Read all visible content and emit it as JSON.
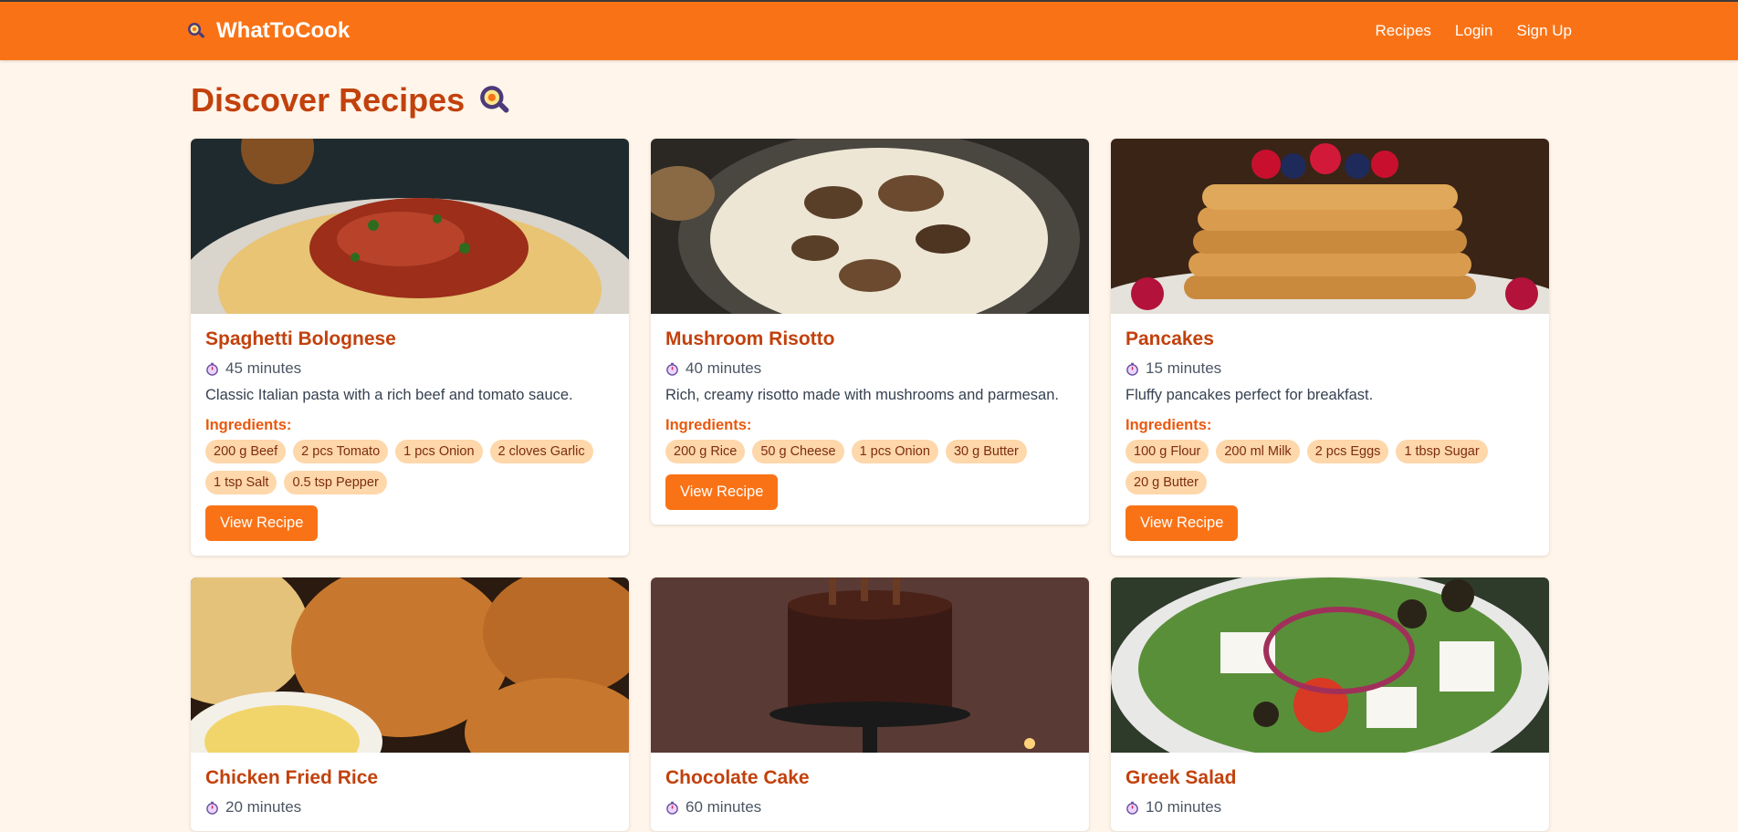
{
  "app": {
    "brand": "WhatToCook"
  },
  "nav": {
    "links": [
      "Recipes",
      "Login",
      "Sign Up"
    ]
  },
  "page": {
    "title": "Discover Recipes"
  },
  "labels": {
    "ingredients": "Ingredients:",
    "view_recipe": "View Recipe"
  },
  "colors": {
    "primary": "#f97316",
    "title": "#c2410c",
    "pill": "#fed7aa",
    "background": "#fff5ea"
  },
  "recipes": [
    {
      "title": "Spaghetti Bolognese",
      "time": "45 minutes",
      "description": "Classic Italian pasta with a rich beef and tomato sauce.",
      "ingredients": [
        "200 g Beef",
        "2 pcs Tomato",
        "1 pcs Onion",
        "2 cloves Garlic",
        "1 tsp Salt",
        "0.5 tsp Pepper"
      ],
      "image": "spaghetti-photo"
    },
    {
      "title": "Mushroom Risotto",
      "time": "40 minutes",
      "description": "Rich, creamy risotto made with mushrooms and parmesan.",
      "ingredients": [
        "200 g Rice",
        "50 g Cheese",
        "1 pcs Onion",
        "30 g Butter"
      ],
      "image": "risotto-photo"
    },
    {
      "title": "Pancakes",
      "time": "15 minutes",
      "description": "Fluffy pancakes perfect for breakfast.",
      "ingredients": [
        "100 g Flour",
        "200 ml Milk",
        "2 pcs Eggs",
        "1 tbsp Sugar",
        "20 g Butter"
      ],
      "image": "pancakes-photo"
    },
    {
      "title": "Chicken Fried Rice",
      "time": "20 minutes",
      "description": "",
      "ingredients": [],
      "image": "fried-chicken-photo"
    },
    {
      "title": "Chocolate Cake",
      "time": "60 minutes",
      "description": "",
      "ingredients": [],
      "image": "chocolate-cake-photo"
    },
    {
      "title": "Greek Salad",
      "time": "10 minutes",
      "description": "",
      "ingredients": [],
      "image": "greek-salad-photo"
    }
  ]
}
